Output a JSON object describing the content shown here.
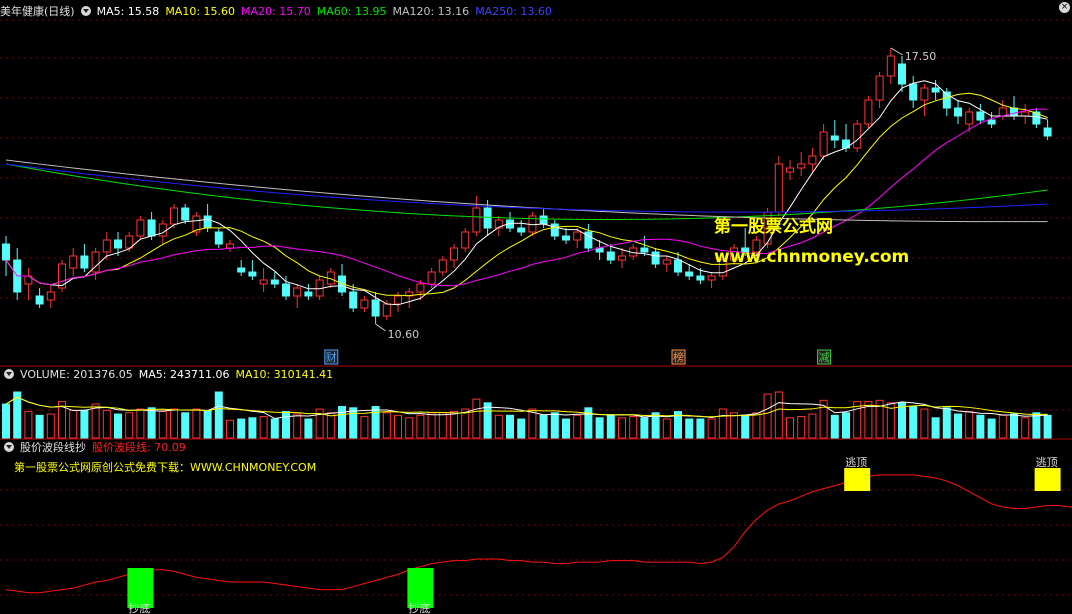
{
  "price_panel": {
    "title": "美年健康(日线)",
    "indicators": [
      {
        "label": "MA5: 15.58",
        "color": "#ffffff"
      },
      {
        "label": "MA10: 15.60",
        "color": "#ffff00"
      },
      {
        "label": "MA20: 15.70",
        "color": "#ff00ff"
      },
      {
        "label": "MA60: 13.95",
        "color": "#00e000"
      },
      {
        "label": "MA120: 13.16",
        "color": "#c0c0c0"
      },
      {
        "label": "MA250: 13.60",
        "color": "#3030ff"
      }
    ],
    "high_label": "17.50",
    "low_label": "10.60",
    "markers": [
      {
        "text": "财",
        "color": "#4aa0ff"
      },
      {
        "text": "榜",
        "color": "#ff9040"
      },
      {
        "text": "减",
        "color": "#40d040"
      }
    ]
  },
  "watermark": {
    "line1": "第一股票公式网",
    "line2": "www.chnmoney.com"
  },
  "volume_panel": {
    "label_volume": "VOLUME: 201376.05",
    "label_ma5": "MA5: 243711.06",
    "label_ma10": "MA10: 310141.41"
  },
  "indicator_panel": {
    "title": "股价波段线抄",
    "value_label": "股价波段线: 70.09",
    "subtitle": "第一股票公式网原创公式免费下载：WWW.CHNMONEY.COM",
    "buy_label": "抄底",
    "sell_label": "逃顶"
  },
  "colors": {
    "up": "#ff3232",
    "down": "#54fcfc",
    "grid": "#7a0000",
    "separator": "#b00000",
    "band_line": "#ff1010",
    "buy": "#00ff00",
    "sell": "#ffff00"
  },
  "chart_data": {
    "type": "candlestick",
    "price_range": [
      10.0,
      18.2
    ],
    "candles": [
      [
        12.6,
        12.8,
        11.8,
        12.2
      ],
      [
        12.2,
        12.5,
        11.2,
        11.4
      ],
      [
        11.6,
        12.0,
        11.2,
        11.8
      ],
      [
        11.3,
        11.5,
        11.0,
        11.1
      ],
      [
        11.2,
        11.6,
        11.0,
        11.4
      ],
      [
        11.5,
        12.2,
        11.4,
        12.1
      ],
      [
        12.0,
        12.5,
        11.8,
        12.3
      ],
      [
        12.3,
        12.6,
        11.9,
        12.0
      ],
      [
        11.9,
        12.5,
        11.7,
        12.4
      ],
      [
        12.4,
        12.9,
        12.2,
        12.7
      ],
      [
        12.7,
        12.9,
        12.3,
        12.5
      ],
      [
        12.5,
        12.9,
        12.4,
        12.8
      ],
      [
        12.8,
        13.3,
        12.7,
        13.2
      ],
      [
        13.2,
        13.4,
        12.7,
        12.8
      ],
      [
        12.8,
        13.2,
        12.6,
        13.1
      ],
      [
        13.1,
        13.6,
        13.0,
        13.5
      ],
      [
        13.5,
        13.6,
        13.1,
        13.2
      ],
      [
        12.9,
        13.4,
        12.8,
        13.3
      ],
      [
        13.3,
        13.6,
        12.9,
        13.0
      ],
      [
        12.9,
        13.0,
        12.5,
        12.6
      ],
      [
        12.5,
        12.7,
        12.4,
        12.6
      ],
      [
        12.0,
        12.2,
        11.8,
        11.9
      ],
      [
        11.9,
        12.2,
        11.7,
        11.8
      ],
      [
        11.6,
        12.0,
        11.4,
        11.7
      ],
      [
        11.7,
        11.9,
        11.5,
        11.6
      ],
      [
        11.6,
        11.8,
        11.2,
        11.3
      ],
      [
        11.3,
        11.6,
        11.0,
        11.5
      ],
      [
        11.4,
        11.6,
        11.2,
        11.3
      ],
      [
        11.3,
        11.8,
        11.2,
        11.7
      ],
      [
        11.6,
        12.0,
        11.5,
        11.9
      ],
      [
        11.8,
        12.1,
        11.3,
        11.4
      ],
      [
        11.4,
        11.6,
        10.9,
        11.0
      ],
      [
        11.0,
        11.3,
        10.9,
        11.2
      ],
      [
        11.2,
        11.4,
        10.6,
        10.8
      ],
      [
        10.8,
        11.2,
        10.7,
        11.1
      ],
      [
        11.1,
        11.4,
        10.9,
        11.3
      ],
      [
        11.3,
        11.5,
        11.0,
        11.4
      ],
      [
        11.4,
        11.7,
        11.2,
        11.6
      ],
      [
        11.6,
        12.0,
        11.5,
        11.9
      ],
      [
        11.9,
        12.3,
        11.8,
        12.2
      ],
      [
        12.2,
        12.6,
        12.0,
        12.5
      ],
      [
        12.5,
        13.0,
        12.4,
        12.9
      ],
      [
        12.9,
        13.8,
        12.8,
        13.5
      ],
      [
        13.5,
        13.7,
        12.8,
        13.0
      ],
      [
        13.0,
        13.3,
        12.8,
        13.2
      ],
      [
        13.2,
        13.4,
        12.9,
        13.0
      ],
      [
        13.0,
        13.2,
        12.8,
        12.9
      ],
      [
        12.9,
        13.4,
        12.8,
        13.3
      ],
      [
        13.3,
        13.5,
        13.0,
        13.1
      ],
      [
        13.1,
        13.2,
        12.7,
        12.8
      ],
      [
        12.8,
        13.0,
        12.6,
        12.7
      ],
      [
        12.7,
        13.0,
        12.5,
        12.9
      ],
      [
        12.9,
        13.1,
        12.4,
        12.5
      ],
      [
        12.5,
        12.7,
        12.2,
        12.4
      ],
      [
        12.4,
        12.6,
        12.1,
        12.2
      ],
      [
        12.2,
        12.5,
        12.0,
        12.3
      ],
      [
        12.3,
        12.6,
        12.2,
        12.5
      ],
      [
        12.5,
        12.8,
        12.3,
        12.4
      ],
      [
        12.4,
        12.5,
        12.0,
        12.1
      ],
      [
        12.1,
        12.3,
        11.9,
        12.2
      ],
      [
        12.2,
        12.4,
        11.8,
        11.9
      ],
      [
        11.9,
        12.1,
        11.7,
        11.8
      ],
      [
        11.8,
        12.0,
        11.6,
        11.7
      ],
      [
        11.7,
        11.9,
        11.5,
        11.8
      ],
      [
        11.8,
        12.3,
        11.7,
        12.2
      ],
      [
        12.2,
        12.6,
        12.1,
        12.5
      ],
      [
        12.5,
        13.0,
        12.3,
        12.4
      ],
      [
        12.4,
        12.8,
        12.3,
        12.7
      ],
      [
        12.6,
        13.5,
        12.5,
        13.4
      ],
      [
        13.4,
        14.8,
        13.3,
        14.6
      ],
      [
        14.4,
        14.7,
        14.2,
        14.5
      ],
      [
        14.5,
        14.9,
        14.3,
        14.6
      ],
      [
        14.6,
        15.0,
        14.4,
        14.8
      ],
      [
        14.8,
        15.6,
        14.7,
        15.4
      ],
      [
        15.3,
        15.7,
        15.0,
        15.2
      ],
      [
        15.2,
        15.6,
        14.9,
        15.0
      ],
      [
        15.0,
        15.7,
        14.9,
        15.6
      ],
      [
        15.6,
        16.3,
        15.5,
        16.2
      ],
      [
        16.2,
        16.9,
        16.0,
        16.8
      ],
      [
        16.8,
        17.5,
        16.6,
        17.3
      ],
      [
        17.1,
        17.3,
        16.4,
        16.6
      ],
      [
        16.6,
        16.8,
        16.0,
        16.2
      ],
      [
        16.2,
        16.6,
        15.8,
        16.5
      ],
      [
        16.5,
        16.7,
        16.2,
        16.4
      ],
      [
        16.4,
        16.5,
        15.8,
        16.0
      ],
      [
        16.0,
        16.2,
        15.6,
        15.8
      ],
      [
        15.6,
        16.0,
        15.4,
        15.9
      ],
      [
        15.9,
        16.1,
        15.6,
        15.7
      ],
      [
        15.7,
        15.9,
        15.5,
        15.6
      ],
      [
        15.8,
        16.2,
        15.7,
        16.0
      ],
      [
        16.0,
        16.3,
        15.7,
        15.8
      ],
      [
        15.8,
        16.1,
        15.6,
        15.9
      ],
      [
        15.9,
        16.0,
        15.5,
        15.6
      ],
      [
        15.5,
        15.7,
        15.2,
        15.3
      ]
    ],
    "volume_range": [
      0,
      480000
    ],
    "band_range": [
      0,
      100
    ],
    "band_line": [
      12,
      11,
      10,
      10,
      11,
      12,
      13,
      15,
      17,
      18,
      20,
      22,
      24,
      25,
      25,
      24,
      22,
      20,
      19,
      18,
      17,
      17,
      17,
      17,
      16,
      15,
      14,
      13,
      12,
      12,
      12,
      14,
      16,
      18,
      20,
      22,
      25,
      27,
      29,
      30,
      31,
      31,
      32,
      32,
      32,
      31,
      31,
      30,
      30,
      29,
      29,
      30,
      30,
      30,
      31,
      31,
      31,
      30,
      30,
      30,
      30,
      30,
      29,
      30,
      33,
      40,
      50,
      58,
      64,
      68,
      70,
      73,
      76,
      78,
      80,
      82,
      84,
      86,
      87,
      87,
      87,
      87,
      86,
      85,
      83,
      80,
      76,
      72,
      68,
      66,
      65,
      65,
      66,
      67,
      67,
      66,
      65
    ]
  }
}
